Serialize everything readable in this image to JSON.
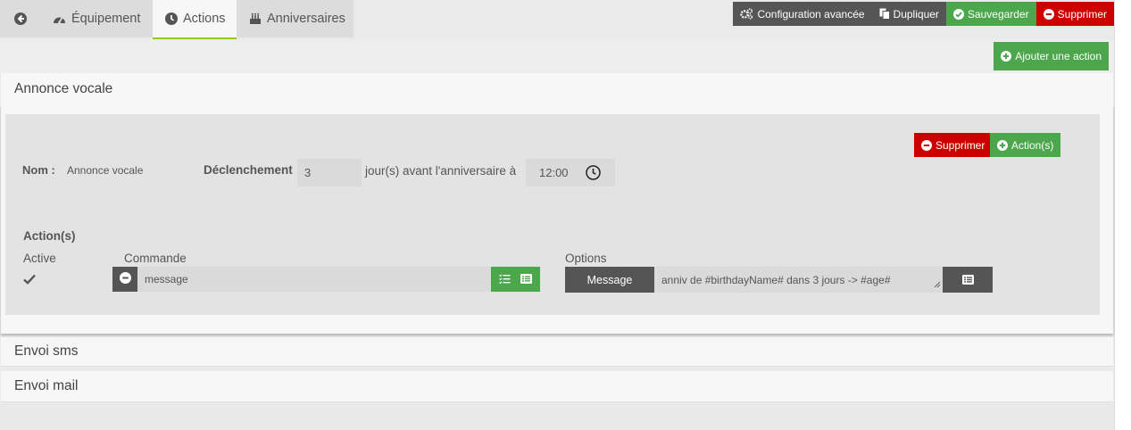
{
  "tabs": [
    {
      "label": "",
      "icon": "arrow-left-circle-icon"
    },
    {
      "label": "Équipement",
      "icon": "tachometer-icon"
    },
    {
      "label": "Actions",
      "icon": "clock-icon"
    },
    {
      "label": "Anniversaires",
      "icon": "birthday-cake-icon"
    }
  ],
  "toolbar": {
    "config_label": "Configuration avancée",
    "duplicate_label": "Dupliquer",
    "save_label": "Sauvegarder",
    "delete_label": "Supprimer"
  },
  "add_action_label": "Ajouter une action",
  "panels": {
    "voice_title": "Annonce vocale",
    "sms_title": "Envoi sms",
    "mail_title": "Envoi mail"
  },
  "voice": {
    "name_label": "Nom :",
    "name_value": "Annonce vocale",
    "trigger_label": "Déclenchement",
    "days_value": "3",
    "days_suffix": "jour(s) avant l'anniversaire à",
    "time_value": "12:00",
    "delete_label": "Supprimer",
    "actions_btn_label": "Action(s)",
    "actions_heading": "Action(s)",
    "col_active": "Active",
    "col_command": "Commande",
    "col_options": "Options",
    "command_value": "message",
    "message_btn_label": "Message",
    "message_value": "anniv de #birthdayName# dans 3 jours -> #age#"
  },
  "colors": {
    "green": "#4ca64c",
    "red": "#cc0000",
    "dark": "#555555",
    "accent_tab": "#94ca02"
  }
}
